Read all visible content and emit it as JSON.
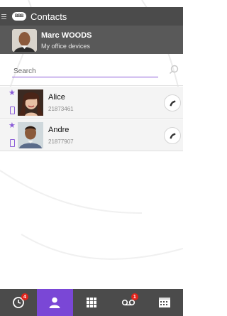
{
  "header": {
    "logo_text": "BBB",
    "title": "Contacts"
  },
  "user": {
    "name": "Marc WOODS",
    "subtitle": "My office devices"
  },
  "search": {
    "placeholder": "Search",
    "value": ""
  },
  "contacts": [
    {
      "name": "Alice",
      "number": "21873461",
      "favorite": true
    },
    {
      "name": "Andre",
      "number": "21877907",
      "favorite": true
    }
  ],
  "tabs": [
    {
      "name": "history",
      "icon": "clock-icon",
      "badge": "4"
    },
    {
      "name": "contacts",
      "icon": "person-icon",
      "active": true
    },
    {
      "name": "dialpad",
      "icon": "grid-icon"
    },
    {
      "name": "voicemail",
      "icon": "voicemail-icon",
      "badge": "1"
    },
    {
      "name": "calendar",
      "icon": "calendar-icon"
    }
  ],
  "colors": {
    "accent": "#7a47d6",
    "header_bg": "#4b4b4b",
    "user_bg": "#595959",
    "badge": "#e2231a"
  }
}
